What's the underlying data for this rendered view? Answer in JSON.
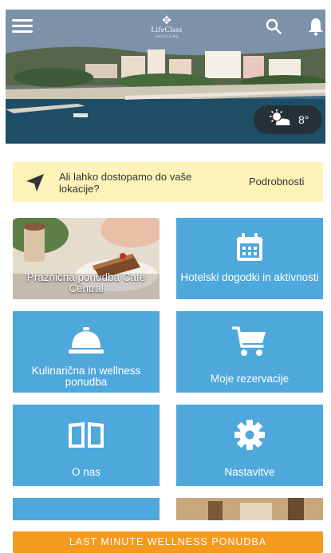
{
  "header": {
    "brand": "LifeClass",
    "brand_sub": "HOTELS & SPA",
    "menu_icon": "hamburger-menu-icon",
    "search_icon": "search-icon",
    "bell_icon": "bell-icon"
  },
  "weather": {
    "icon": "partly-cloudy-icon",
    "temperature": "8°"
  },
  "location_prompt": {
    "icon": "navigation-arrow-icon",
    "question": "Ali lahko dostopamo do vaše lokacije?",
    "action_label": "Podrobnosti",
    "background": "#fdf3b8"
  },
  "tiles": [
    {
      "label": "Praznična ponudba Café Central",
      "icon": "cafe-photo"
    },
    {
      "label": "Hotelski dogodki in aktivnosti",
      "icon": "calendar-icon"
    },
    {
      "label": "Kulinarična in wellness ponudba",
      "icon": "service-bell-icon"
    },
    {
      "label": "Moje rezervacije",
      "icon": "shopping-cart-icon"
    },
    {
      "label": "O nas",
      "icon": "open-book-icon"
    },
    {
      "label": "Nastavitve",
      "icon": "gear-icon"
    }
  ],
  "cta": {
    "label": "LAST MINUTE WELLNESS PONUDBA",
    "color": "#f39a1f"
  },
  "colors": {
    "tile_blue": "#4fa8dc",
    "banner_yellow": "#fdf3b8",
    "cta_orange": "#f39a1f"
  }
}
